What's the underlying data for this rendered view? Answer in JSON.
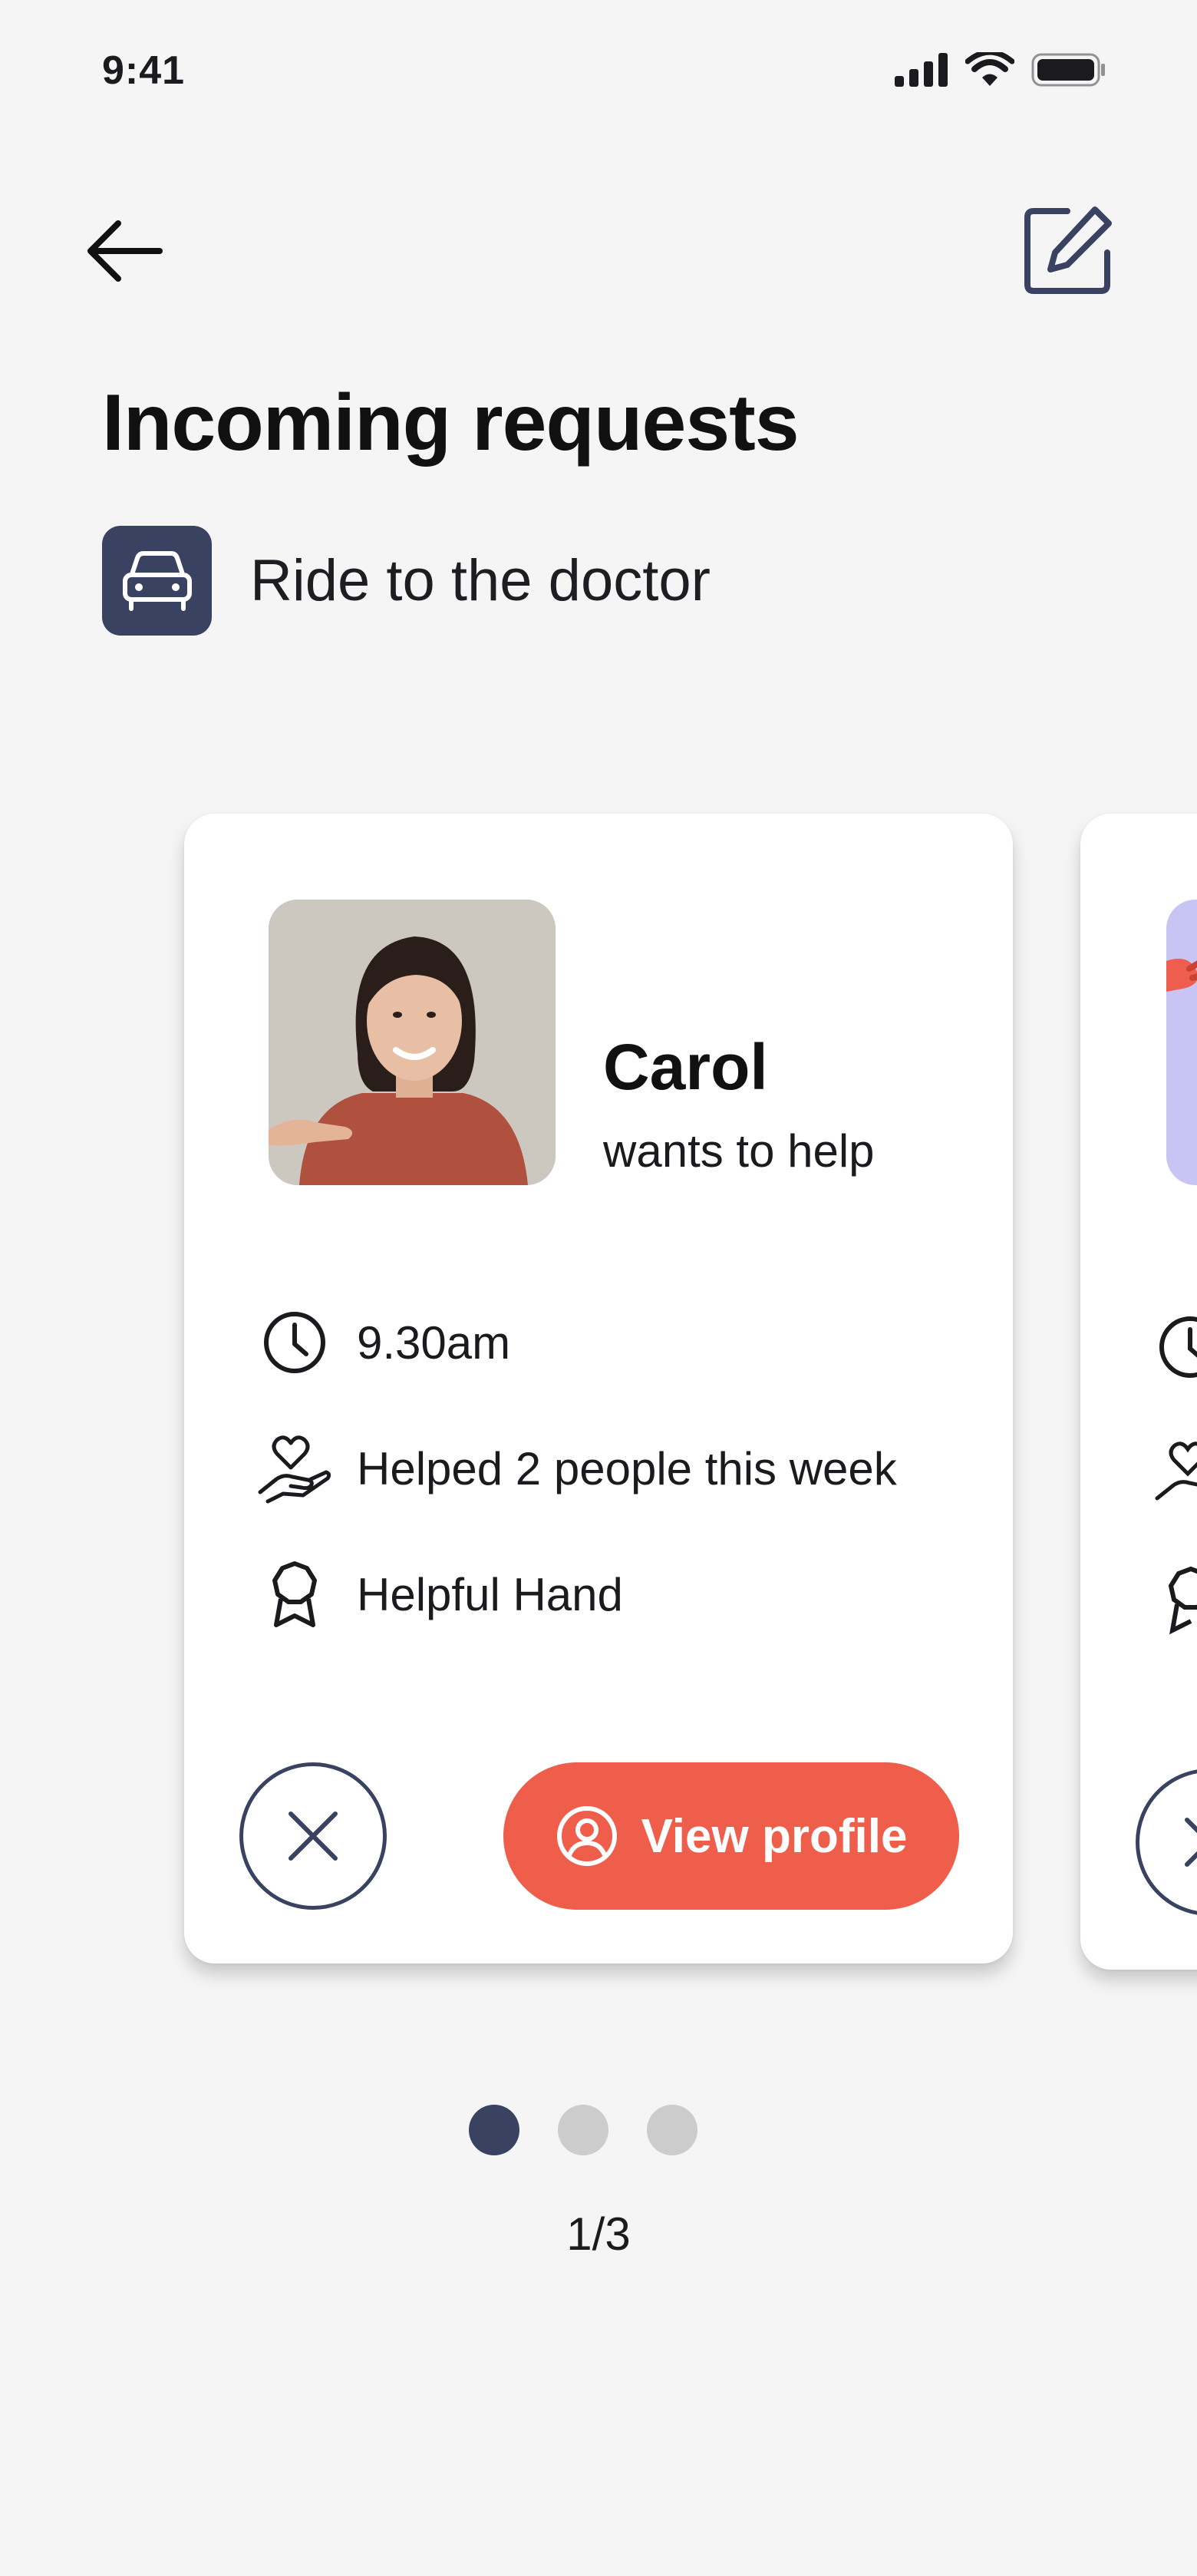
{
  "status_bar": {
    "time": "9:41"
  },
  "header": {
    "back_icon": "arrow-left-icon",
    "edit_icon": "edit-icon",
    "title": "Incoming requests"
  },
  "request": {
    "category_icon": "car-icon",
    "label": "Ride to the doctor"
  },
  "cards": [
    {
      "name": "Carol",
      "subtitle": "wants to help",
      "details": [
        {
          "icon": "clock-icon",
          "text": "9.30am"
        },
        {
          "icon": "heart-hand-icon",
          "text": "Helped 2 people this week"
        },
        {
          "icon": "award-icon",
          "text": "Helpful Hand"
        }
      ],
      "decline_icon": "close-icon",
      "view_profile_label": "View profile"
    }
  ],
  "pagination": {
    "total": 3,
    "current": 1,
    "label": "1/3"
  },
  "colors": {
    "primary": "#394260",
    "accent": "#ef5d4b",
    "background": "#f5f5f5",
    "peek_avatar": "#c8c4f4"
  }
}
